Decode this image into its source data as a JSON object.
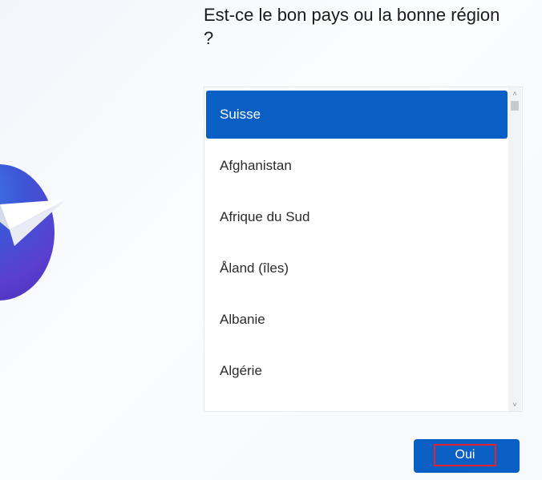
{
  "header": {
    "title": "Est-ce le bon pays ou la bonne région ?"
  },
  "country_list": {
    "items": [
      {
        "label": "Suisse",
        "selected": true
      },
      {
        "label": "Afghanistan",
        "selected": false
      },
      {
        "label": "Afrique du Sud",
        "selected": false
      },
      {
        "label": "Åland (îles)",
        "selected": false
      },
      {
        "label": "Albanie",
        "selected": false
      },
      {
        "label": "Algérie",
        "selected": false
      }
    ],
    "scroll_up_glyph": "˄",
    "scroll_down_glyph": "˅"
  },
  "footer": {
    "yes_label": "Oui"
  },
  "colors": {
    "accent": "#0a5fc4",
    "focus_outline": "#e3222c",
    "globe": "#3d55d6"
  },
  "icons": {
    "illustration": "globe-with-paper-plane-icon"
  }
}
